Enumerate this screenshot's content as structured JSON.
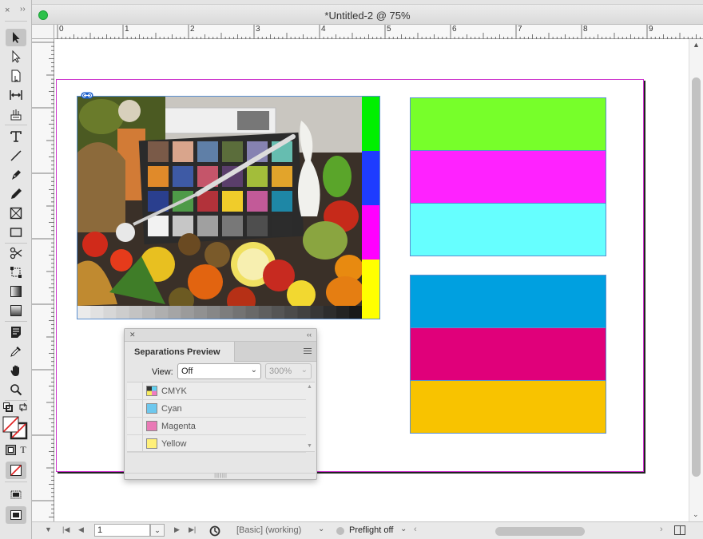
{
  "window": {
    "title": "*Untitled-2 @ 75%"
  },
  "ruler": {
    "h_labels": [
      "0",
      "1",
      "2",
      "3",
      "4",
      "5",
      "6",
      "7",
      "8",
      "9"
    ]
  },
  "tools_panel": {
    "close_glyph": "×",
    "collapse_glyph": "››",
    "tools": [
      "selection-tool",
      "direct-selection-tool",
      "page-tool",
      "gap-tool",
      "content-collector-tool",
      "type-tool",
      "line-tool",
      "pen-tool",
      "pencil-tool",
      "rectangle-frame-tool",
      "rectangle-tool",
      "scissors-tool",
      "free-transform-tool",
      "gradient-swatch-tool",
      "gradient-feather-tool",
      "note-tool",
      "eyedropper-tool",
      "hand-tool",
      "zoom-tool"
    ],
    "formatting_text_glyph": "T"
  },
  "document": {
    "zoom": "75%",
    "page_frame_color": "#cc33cc",
    "photo_strip_colors": [
      "#00f000",
      "#1e3cff",
      "#ff00ff",
      "#ffff00"
    ],
    "rgb_bar_colors": [
      "#77ff2a",
      "#ff22ff",
      "#66ffff"
    ],
    "cmyk_bar_colors": [
      "#00a0e0",
      "#e0007a",
      "#f8c300"
    ]
  },
  "separations_panel": {
    "title": "Separations Preview",
    "view_label": "View:",
    "view_value": "Off",
    "zoom_value": "300%",
    "separations": [
      {
        "label": "CMYK",
        "swatch": "cmyk"
      },
      {
        "label": "Cyan",
        "swatch": "#6ec8ee"
      },
      {
        "label": "Magenta",
        "swatch": "#e97ab6"
      },
      {
        "label": "Yellow",
        "swatch": "#fff07a"
      }
    ]
  },
  "status_bar": {
    "page_number": "1",
    "style": "[Basic] (working)",
    "preflight": "Preflight off"
  }
}
